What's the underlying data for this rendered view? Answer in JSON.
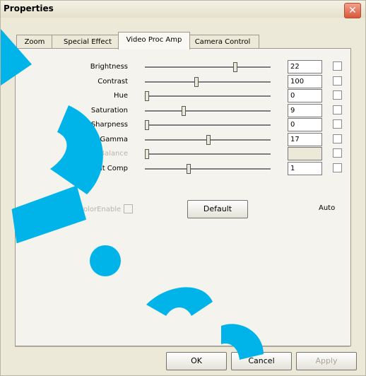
{
  "window": {
    "title": "Properties"
  },
  "tabs": [
    {
      "label": "Zoom",
      "active": false
    },
    {
      "label": "Special Effect",
      "active": false
    },
    {
      "label": "Video Proc Amp",
      "active": true
    },
    {
      "label": "Camera Control",
      "active": false
    }
  ],
  "rows": [
    {
      "label": "Brightness",
      "value": "22",
      "level": 0.72,
      "enabled": true
    },
    {
      "label": "Contrast",
      "value": "100",
      "level": 0.4,
      "enabled": true
    },
    {
      "label": "Hue",
      "value": "0",
      "level": 0.0,
      "enabled": true
    },
    {
      "label": "Saturation",
      "value": "9",
      "level": 0.3,
      "enabled": true
    },
    {
      "label": "Sharpness",
      "value": "0",
      "level": 0.0,
      "enabled": true
    },
    {
      "label": "Gamma",
      "value": "17",
      "level": 0.5,
      "enabled": true
    },
    {
      "label": "White Balance",
      "value": "",
      "level": 0.0,
      "enabled": false
    },
    {
      "label": "Backlight Comp",
      "value": "1",
      "level": 0.34,
      "enabled": true
    }
  ],
  "color_enable_label": "ColorEnable",
  "default_button": "Default",
  "auto_label": "Auto",
  "buttons": {
    "ok": "OK",
    "cancel": "Cancel",
    "apply": "Apply"
  },
  "watermark": {
    "color": "#00b4ea"
  },
  "icons": {
    "close": "close-icon"
  }
}
